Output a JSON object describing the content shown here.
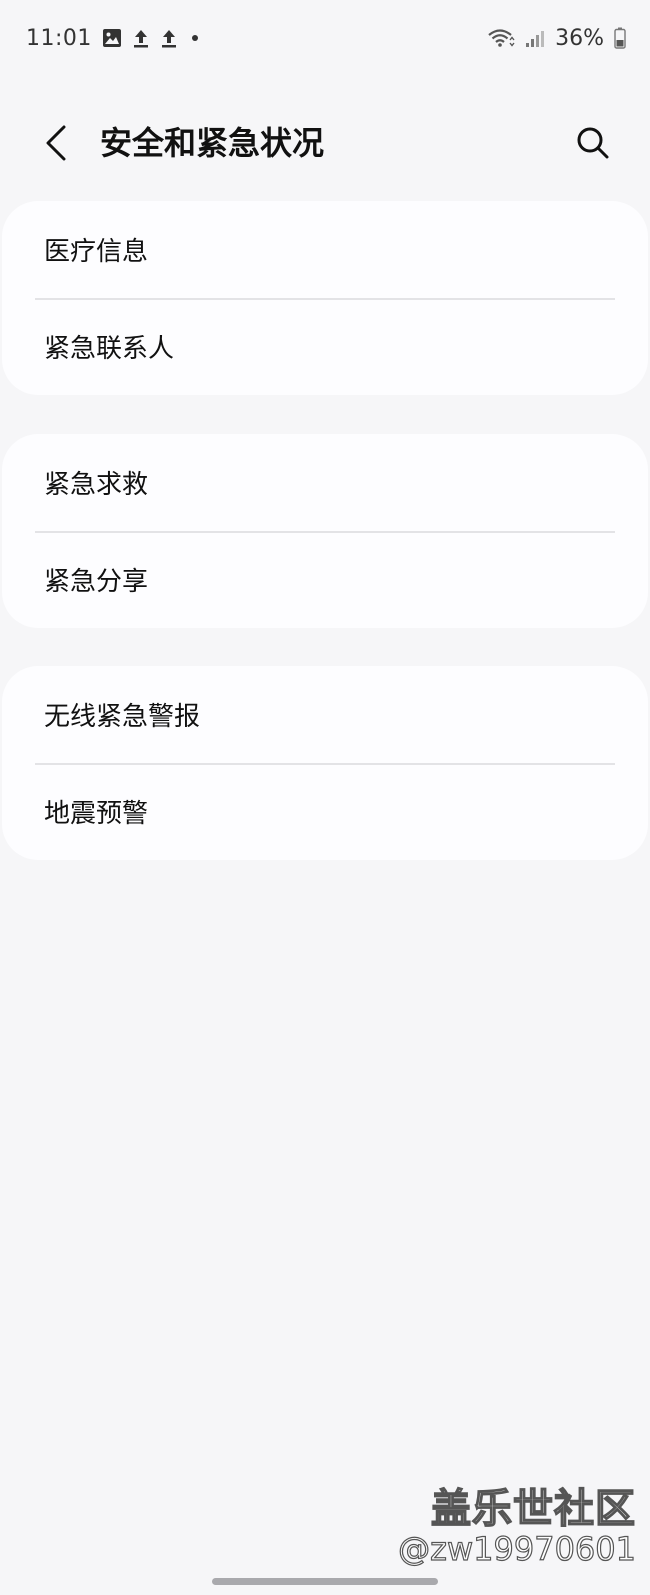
{
  "status_bar": {
    "time": "11:01",
    "battery": "36%",
    "icons": [
      "image-icon",
      "upload-icon",
      "upload-icon",
      "notification-dot",
      "wifi-icon",
      "signal-icon",
      "battery-icon"
    ]
  },
  "header": {
    "title": "安全和紧急状况",
    "back_icon": "chevron-left-icon",
    "search_icon": "search-icon"
  },
  "groups": [
    {
      "items": [
        {
          "label": "医疗信息"
        },
        {
          "label": "紧急联系人"
        }
      ]
    },
    {
      "items": [
        {
          "label": "紧急求救"
        },
        {
          "label": "紧急分享"
        }
      ]
    },
    {
      "items": [
        {
          "label": "无线紧急警报"
        },
        {
          "label": "地震预警"
        }
      ]
    }
  ],
  "watermark": {
    "line1": "盖乐世社区",
    "line2": "@zw19970601"
  },
  "colors": {
    "background": "#f6f6f8",
    "card": "#fdfdff",
    "divider": "#e3e3e6",
    "text": "#111111"
  }
}
